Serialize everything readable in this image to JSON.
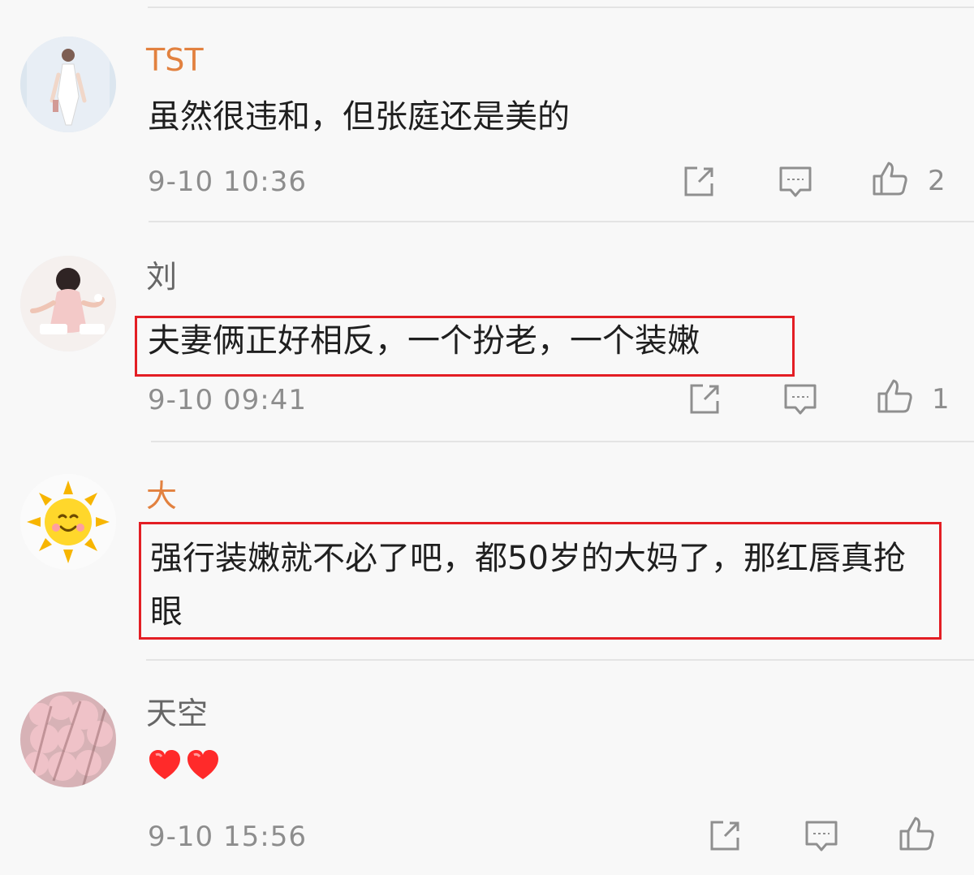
{
  "comments": [
    {
      "username": "TST",
      "username_color": "#e2813f",
      "text": "虽然很违和，但张庭还是美的",
      "time": "9-10 10:36",
      "likes": "2",
      "highlighted": false,
      "avatar": "woman-in-white-dress"
    },
    {
      "username": "刘",
      "username_color": "#666666",
      "text": "夫妻俩正好相反，一个扮老，一个装嫩",
      "time": "9-10 09:41",
      "likes": "1",
      "highlighted": true,
      "avatar": "woman-in-pink"
    },
    {
      "username": "大",
      "username_color": "#e2813f",
      "text": "强行装嫩就不必了吧，都50岁的大妈了，那红唇真抢眼",
      "time": "",
      "likes": "",
      "highlighted": true,
      "avatar": "smiling-sun"
    },
    {
      "username": "天空",
      "username_color": "#666666",
      "text": "",
      "emoji": "heart heart",
      "time": "9-10 15:56",
      "likes": "",
      "highlighted": false,
      "avatar": "pink-blossoms"
    }
  ],
  "icons": {
    "share": "share-icon",
    "reply": "comment-icon",
    "like": "thumbs-up-icon"
  },
  "colors": {
    "highlight_box": "#e31e24",
    "icon_gray": "#8f8f8f"
  }
}
